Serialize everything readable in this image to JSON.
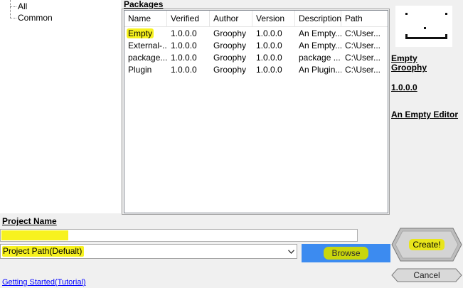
{
  "tree": {
    "items": [
      {
        "label": "All"
      },
      {
        "label": "Common"
      }
    ]
  },
  "packages": {
    "title": "Packages",
    "columns": [
      "Name",
      "Verified",
      "Author",
      "Version",
      "Description",
      "Path"
    ],
    "rows": [
      {
        "name": "Empty",
        "verified": "1.0.0.0",
        "author": "Groophy",
        "version": "1.0.0.0",
        "description": "An Empty...",
        "path": "C:\\User..."
      },
      {
        "name": "External-...",
        "verified": "1.0.0.0",
        "author": "Groophy",
        "version": "1.0.0.0",
        "description": "An Empty...",
        "path": "C:\\User..."
      },
      {
        "name": "package...",
        "verified": "1.0.0.0",
        "author": "Groophy",
        "version": "1.0.0.0",
        "description": "package ...",
        "path": "C:\\User..."
      },
      {
        "name": "Plugin",
        "verified": "1.0.0.0",
        "author": "Groophy",
        "version": "1.0.0.0",
        "description": "An Plugin...",
        "path": "C:\\User..."
      }
    ]
  },
  "details": {
    "name": "Empty",
    "author": "Groophy",
    "version": "1.0.0.0",
    "description": "An Empty Editor"
  },
  "project": {
    "name_label": "Project Name",
    "name_value": "",
    "path_value": "Project Path(Defualt)",
    "browse_label": "Browse",
    "create_label": "Create!",
    "cancel_label": "Cancel",
    "link_label": "Getting Started(Tutorial)"
  },
  "colors": {
    "highlight": "#f7f21f",
    "browse_bg": "#3c8bf0",
    "link": "#0000ff"
  }
}
